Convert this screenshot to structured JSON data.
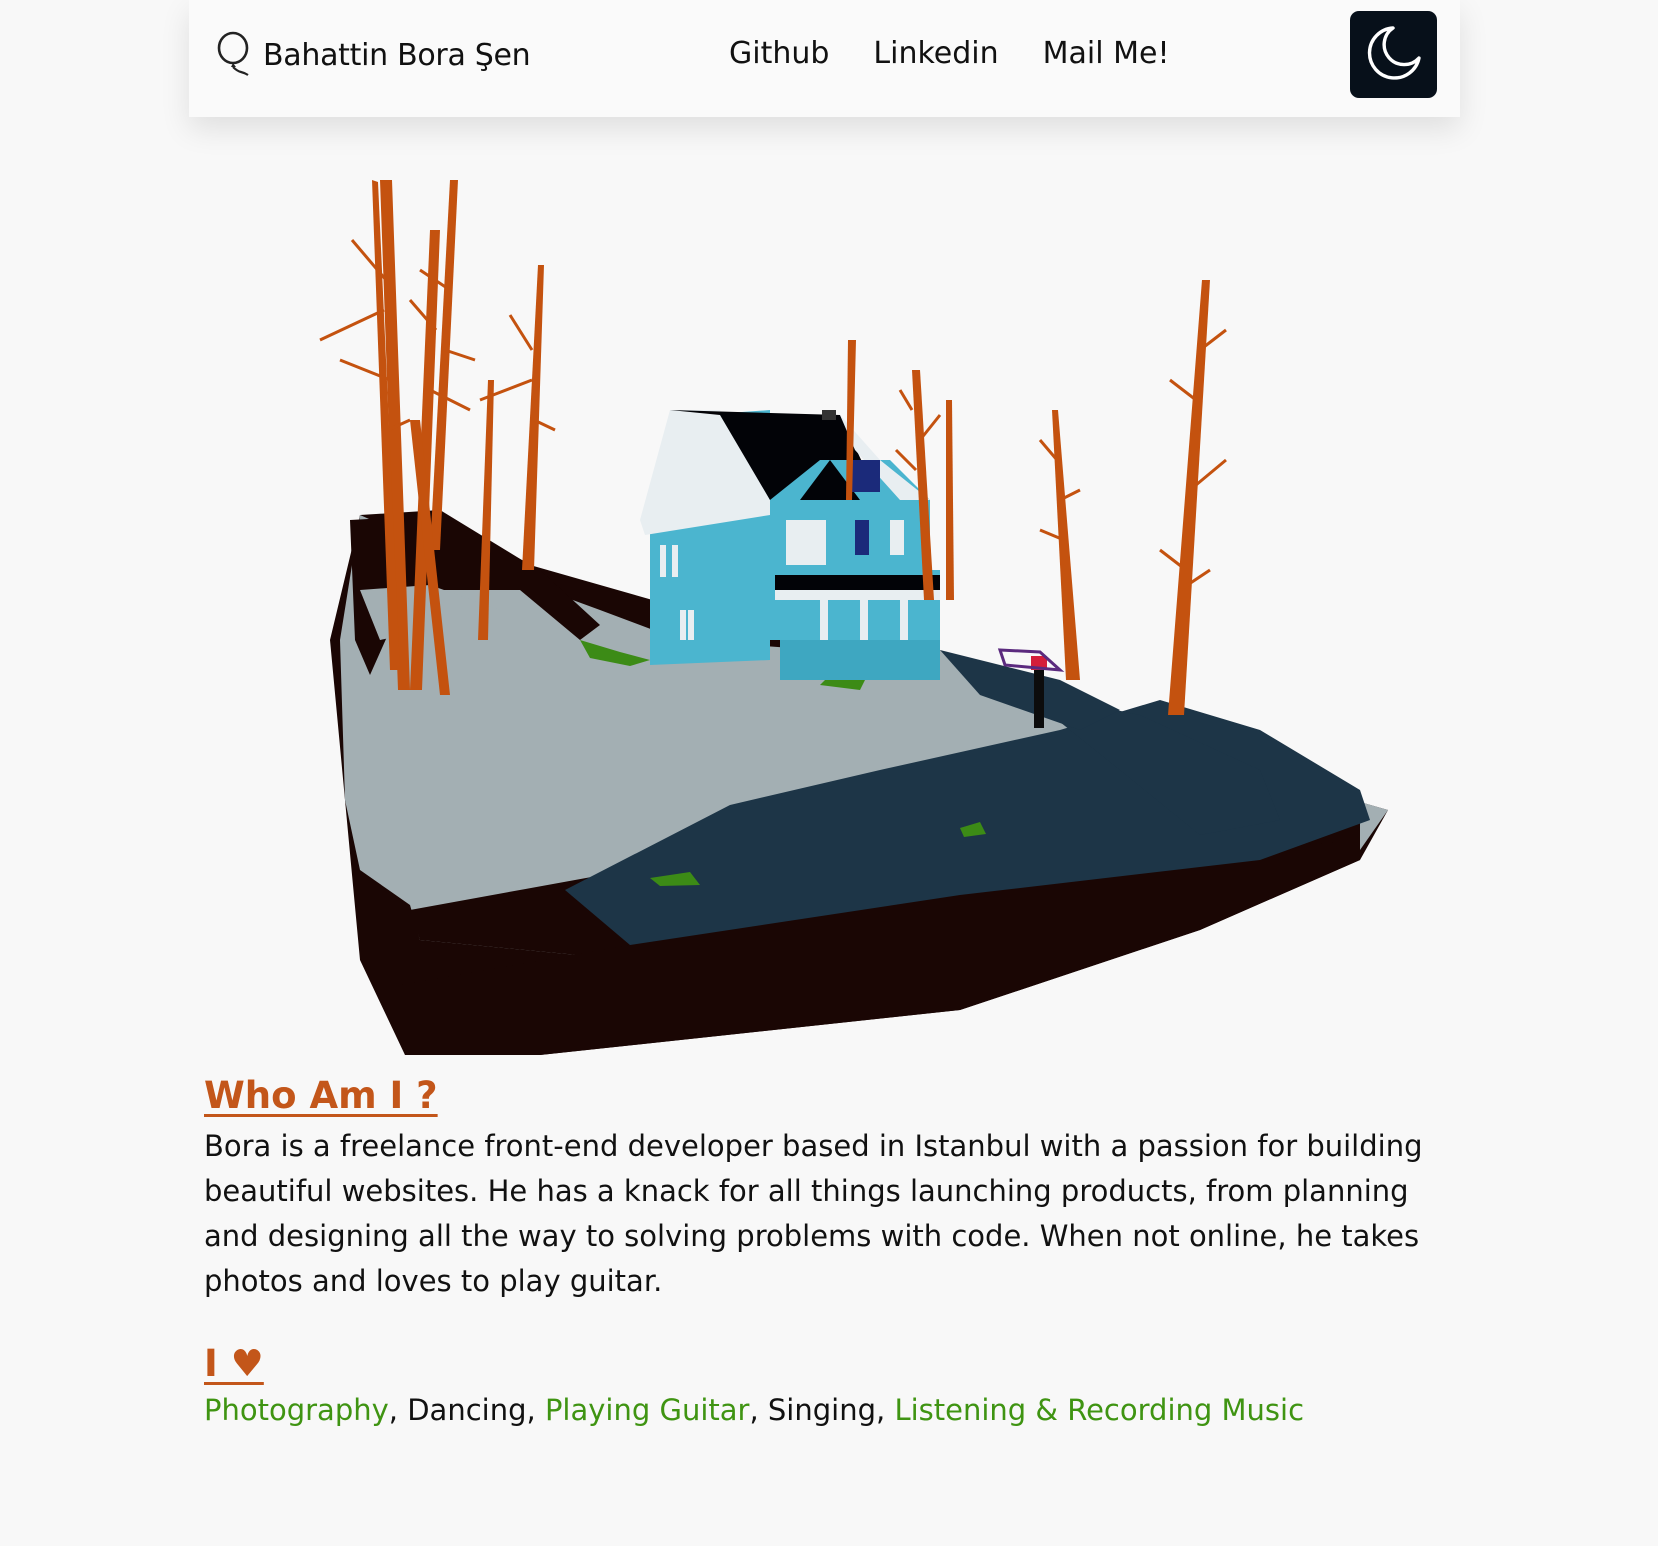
{
  "header": {
    "brand_icon": "balloon-outline-icon",
    "brand_name": "Bahattin Bora Şen",
    "nav": [
      {
        "label": "Github"
      },
      {
        "label": "Linkedin"
      },
      {
        "label": "Mail Me!"
      }
    ],
    "theme_toggle_icon": "moon-icon"
  },
  "hero": {
    "illustration": "low-poly 3D house on a cliff with bare orange trees"
  },
  "about": {
    "title": "Who Am I ?",
    "bio": "Bora is a freelance front-end developer based in Istanbul with a passion for building beautiful websites. He has a knack for all things launching products, from planning and designing all the way to solving problems with code. When not online, he takes photos and loves to play guitar."
  },
  "loves": {
    "title": "I ♥",
    "items": [
      {
        "label": "Photography",
        "link": true
      },
      {
        "label": "Dancing",
        "link": false
      },
      {
        "label": "Playing Guitar",
        "link": true
      },
      {
        "label": "Singing",
        "link": false
      },
      {
        "label": "Listening & Recording Music",
        "link": true
      }
    ]
  },
  "colors": {
    "accent": "#c3561a",
    "link_green": "#3f9412",
    "toggle_bg": "#07101a",
    "page_bg": "#f8f8f8"
  }
}
